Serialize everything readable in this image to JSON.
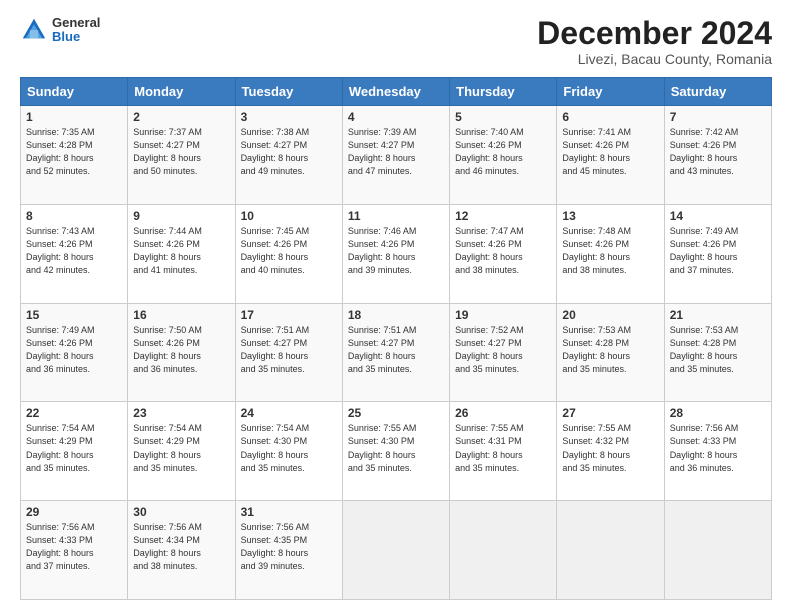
{
  "logo": {
    "general": "General",
    "blue": "Blue"
  },
  "title": "December 2024",
  "subtitle": "Livezi, Bacau County, Romania",
  "days_header": [
    "Sunday",
    "Monday",
    "Tuesday",
    "Wednesday",
    "Thursday",
    "Friday",
    "Saturday"
  ],
  "weeks": [
    [
      {
        "day": "1",
        "info": "Sunrise: 7:35 AM\nSunset: 4:28 PM\nDaylight: 8 hours\nand 52 minutes."
      },
      {
        "day": "2",
        "info": "Sunrise: 7:37 AM\nSunset: 4:27 PM\nDaylight: 8 hours\nand 50 minutes."
      },
      {
        "day": "3",
        "info": "Sunrise: 7:38 AM\nSunset: 4:27 PM\nDaylight: 8 hours\nand 49 minutes."
      },
      {
        "day": "4",
        "info": "Sunrise: 7:39 AM\nSunset: 4:27 PM\nDaylight: 8 hours\nand 47 minutes."
      },
      {
        "day": "5",
        "info": "Sunrise: 7:40 AM\nSunset: 4:26 PM\nDaylight: 8 hours\nand 46 minutes."
      },
      {
        "day": "6",
        "info": "Sunrise: 7:41 AM\nSunset: 4:26 PM\nDaylight: 8 hours\nand 45 minutes."
      },
      {
        "day": "7",
        "info": "Sunrise: 7:42 AM\nSunset: 4:26 PM\nDaylight: 8 hours\nand 43 minutes."
      }
    ],
    [
      {
        "day": "8",
        "info": "Sunrise: 7:43 AM\nSunset: 4:26 PM\nDaylight: 8 hours\nand 42 minutes."
      },
      {
        "day": "9",
        "info": "Sunrise: 7:44 AM\nSunset: 4:26 PM\nDaylight: 8 hours\nand 41 minutes."
      },
      {
        "day": "10",
        "info": "Sunrise: 7:45 AM\nSunset: 4:26 PM\nDaylight: 8 hours\nand 40 minutes."
      },
      {
        "day": "11",
        "info": "Sunrise: 7:46 AM\nSunset: 4:26 PM\nDaylight: 8 hours\nand 39 minutes."
      },
      {
        "day": "12",
        "info": "Sunrise: 7:47 AM\nSunset: 4:26 PM\nDaylight: 8 hours\nand 38 minutes."
      },
      {
        "day": "13",
        "info": "Sunrise: 7:48 AM\nSunset: 4:26 PM\nDaylight: 8 hours\nand 38 minutes."
      },
      {
        "day": "14",
        "info": "Sunrise: 7:49 AM\nSunset: 4:26 PM\nDaylight: 8 hours\nand 37 minutes."
      }
    ],
    [
      {
        "day": "15",
        "info": "Sunrise: 7:49 AM\nSunset: 4:26 PM\nDaylight: 8 hours\nand 36 minutes."
      },
      {
        "day": "16",
        "info": "Sunrise: 7:50 AM\nSunset: 4:26 PM\nDaylight: 8 hours\nand 36 minutes."
      },
      {
        "day": "17",
        "info": "Sunrise: 7:51 AM\nSunset: 4:27 PM\nDaylight: 8 hours\nand 35 minutes."
      },
      {
        "day": "18",
        "info": "Sunrise: 7:51 AM\nSunset: 4:27 PM\nDaylight: 8 hours\nand 35 minutes."
      },
      {
        "day": "19",
        "info": "Sunrise: 7:52 AM\nSunset: 4:27 PM\nDaylight: 8 hours\nand 35 minutes."
      },
      {
        "day": "20",
        "info": "Sunrise: 7:53 AM\nSunset: 4:28 PM\nDaylight: 8 hours\nand 35 minutes."
      },
      {
        "day": "21",
        "info": "Sunrise: 7:53 AM\nSunset: 4:28 PM\nDaylight: 8 hours\nand 35 minutes."
      }
    ],
    [
      {
        "day": "22",
        "info": "Sunrise: 7:54 AM\nSunset: 4:29 PM\nDaylight: 8 hours\nand 35 minutes."
      },
      {
        "day": "23",
        "info": "Sunrise: 7:54 AM\nSunset: 4:29 PM\nDaylight: 8 hours\nand 35 minutes."
      },
      {
        "day": "24",
        "info": "Sunrise: 7:54 AM\nSunset: 4:30 PM\nDaylight: 8 hours\nand 35 minutes."
      },
      {
        "day": "25",
        "info": "Sunrise: 7:55 AM\nSunset: 4:30 PM\nDaylight: 8 hours\nand 35 minutes."
      },
      {
        "day": "26",
        "info": "Sunrise: 7:55 AM\nSunset: 4:31 PM\nDaylight: 8 hours\nand 35 minutes."
      },
      {
        "day": "27",
        "info": "Sunrise: 7:55 AM\nSunset: 4:32 PM\nDaylight: 8 hours\nand 35 minutes."
      },
      {
        "day": "28",
        "info": "Sunrise: 7:56 AM\nSunset: 4:33 PM\nDaylight: 8 hours\nand 36 minutes."
      }
    ],
    [
      {
        "day": "29",
        "info": "Sunrise: 7:56 AM\nSunset: 4:33 PM\nDaylight: 8 hours\nand 37 minutes."
      },
      {
        "day": "30",
        "info": "Sunrise: 7:56 AM\nSunset: 4:34 PM\nDaylight: 8 hours\nand 38 minutes."
      },
      {
        "day": "31",
        "info": "Sunrise: 7:56 AM\nSunset: 4:35 PM\nDaylight: 8 hours\nand 39 minutes."
      },
      {
        "day": "",
        "info": ""
      },
      {
        "day": "",
        "info": ""
      },
      {
        "day": "",
        "info": ""
      },
      {
        "day": "",
        "info": ""
      }
    ]
  ]
}
